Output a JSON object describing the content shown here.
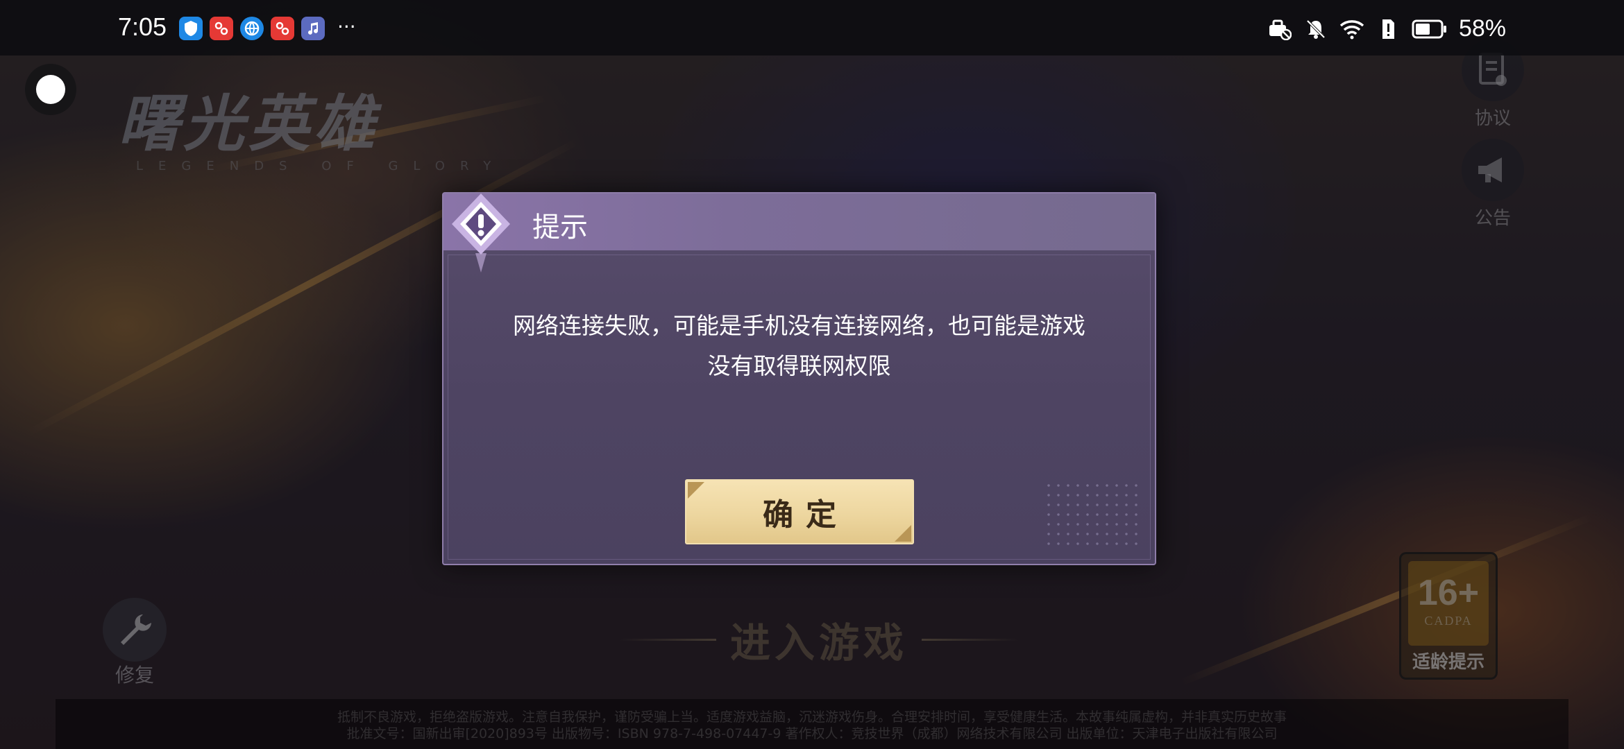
{
  "status_bar": {
    "time": "7:05",
    "notification_icons": [
      {
        "name": "shield-app-icon",
        "color": "#1e88e5"
      },
      {
        "name": "video-app-icon",
        "color": "#e53935"
      },
      {
        "name": "browser-app-icon",
        "color": "#1e88e5"
      },
      {
        "name": "video-app-icon",
        "color": "#e53935"
      },
      {
        "name": "music-app-icon",
        "color": "#5c6bc0"
      }
    ],
    "more": "···",
    "battery_percent": "58%"
  },
  "game": {
    "logo_title": "曙光英雄",
    "logo_subtitle": "LEGENDS OF GLORY",
    "agreement_label": "协议",
    "announcement_label": "公告",
    "repair_label": "修复",
    "enter_game_label": "进入游戏",
    "age_rating": {
      "number": "16+",
      "org": "CADPA",
      "label": "适龄提示"
    },
    "footer_line1": "抵制不良游戏，拒绝盗版游戏。注意自我保护，谨防受骗上当。适度游戏益脑，沉迷游戏伤身。合理安排时间，享受健康生活。本故事纯属虚构，并非真实历史故事",
    "footer_line2": "批准文号：国新出审[2020]893号  出版物号：ISBN 978-7-498-07447-9  著作权人：竞技世界（成都）网络技术有限公司  出版单位：天津电子出版社有限公司"
  },
  "dialog": {
    "title": "提示",
    "message": "网络连接失败，可能是手机没有连接网络，也可能是游戏没有取得联网权限",
    "confirm_label": "确定"
  }
}
